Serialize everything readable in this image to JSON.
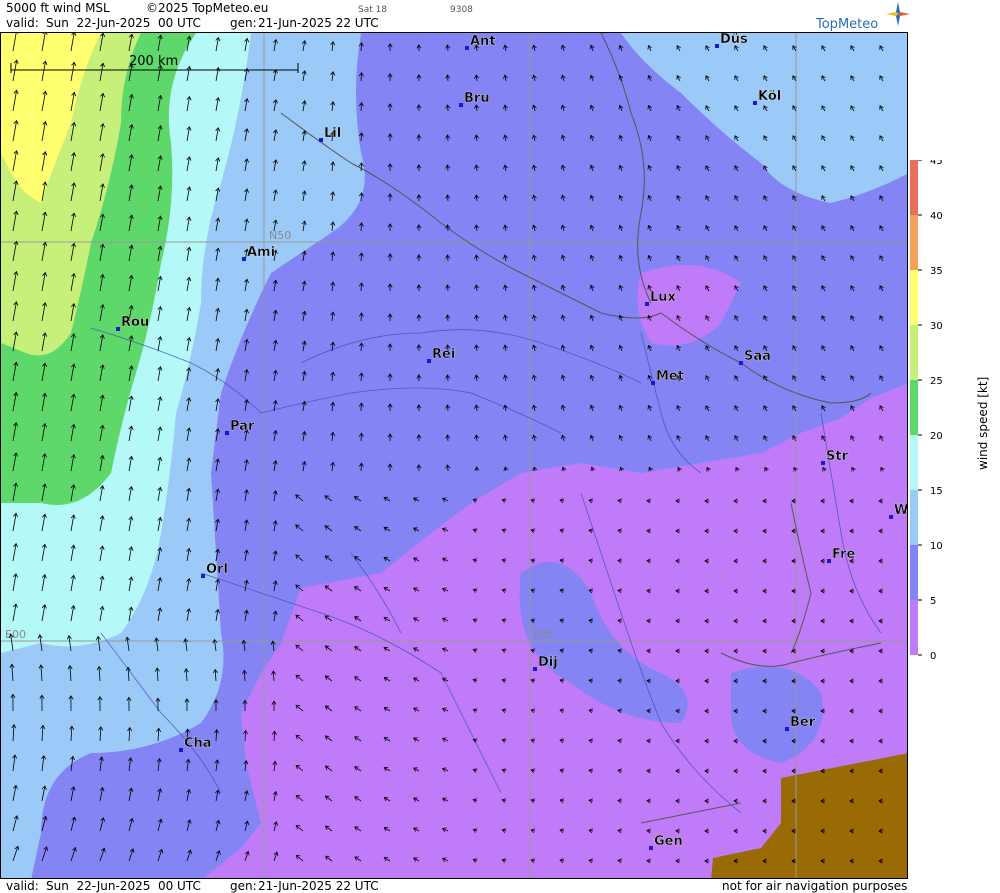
{
  "header": {
    "product": "5000 ft wind MSL",
    "copyright": "©2025 TopMeteo.eu",
    "day": "Sat 18",
    "code": "9308",
    "valid_label": "valid:",
    "valid_value": "Sun  22-Jun-2025  00 UTC",
    "gen_label": "gen:",
    "gen_value": "21-Jun-2025 22 UTC",
    "brand": "TopMeteo"
  },
  "footer": {
    "valid_label": "valid:",
    "valid_value": "Sun  22-Jun-2025  00 UTC",
    "gen_label": "gen:",
    "gen_value": "21-Jun-2025 22 UTC",
    "disclaimer": "not for air navigation purposes"
  },
  "map": {
    "scale_bar": "200 km",
    "grid_labels": {
      "lat_n50": "N50",
      "lon_e00": "E00",
      "lon_e05": "E05"
    },
    "cities": [
      {
        "name": "Ant"
      },
      {
        "name": "Düs"
      },
      {
        "name": "Bru"
      },
      {
        "name": "Köl"
      },
      {
        "name": "Lil"
      },
      {
        "name": "Ami"
      },
      {
        "name": "Lux"
      },
      {
        "name": "Rou"
      },
      {
        "name": "Rei"
      },
      {
        "name": "Saa"
      },
      {
        "name": "Met"
      },
      {
        "name": "Par"
      },
      {
        "name": "Str"
      },
      {
        "name": "W"
      },
      {
        "name": "Orl"
      },
      {
        "name": "Fre"
      },
      {
        "name": "Dij"
      },
      {
        "name": "Ber"
      },
      {
        "name": "Cha"
      },
      {
        "name": "Gen"
      }
    ]
  },
  "legend": {
    "title": "wind  speed  [kt]",
    "ticks": [
      "45",
      "40",
      "35",
      "30",
      "25",
      "20",
      "15",
      "10",
      "5",
      "0"
    ],
    "colors": [
      "#e8705a",
      "#f4a25a",
      "#ffff70",
      "#c6f07a",
      "#5ed86a",
      "#b4f8f8",
      "#9ccaf8",
      "#8484f4",
      "#c07cf8"
    ]
  },
  "colors": {
    "purple": "#c07cf8",
    "violet": "#8484f4",
    "lightblue": "#9ccaf8",
    "cyan": "#b4f8f8",
    "green": "#5ed86a",
    "lightgreen": "#c6f07a",
    "yellow": "#ffff70",
    "terrain": "#9a6a04"
  }
}
